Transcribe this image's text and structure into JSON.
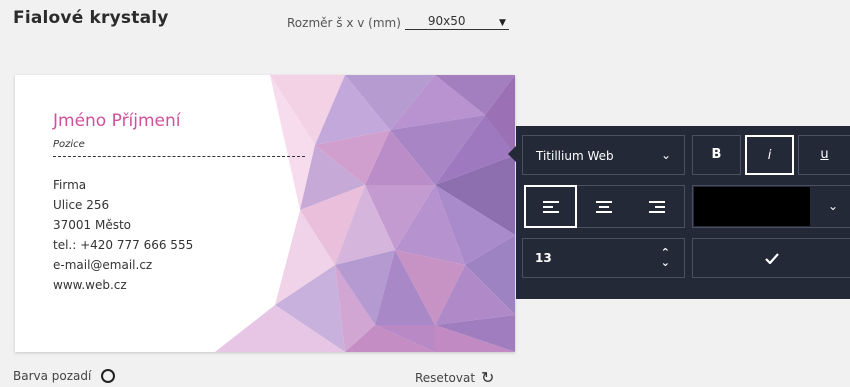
{
  "header": {
    "title": "Fialové krystaly",
    "size_label": "Rozměr š x v (mm)",
    "size_value": "90x50"
  },
  "card": {
    "name": "Jméno Příjmení",
    "position": "Pozice",
    "lines": [
      "Firma",
      "Ulice 256",
      "37001 Město",
      "tel.: +420 777 666 555",
      "e-mail@email.cz",
      "www.web.cz"
    ],
    "accent_color": "#d14f9c"
  },
  "toolbar": {
    "font": "Titillium Web",
    "bold": "B",
    "italic": "i",
    "underline": "u",
    "alignment_selected": "left",
    "text_color": "#000000",
    "font_size": "13",
    "background": "#232937"
  },
  "footer": {
    "bg_color_label": "Barva pozadí",
    "reset_label": "Resetovat"
  },
  "icons": [
    "chevron-down-icon",
    "align-left-icon",
    "align-center-icon",
    "align-right-icon",
    "spinner-icon",
    "check-icon",
    "circle-icon",
    "reset-icon"
  ]
}
